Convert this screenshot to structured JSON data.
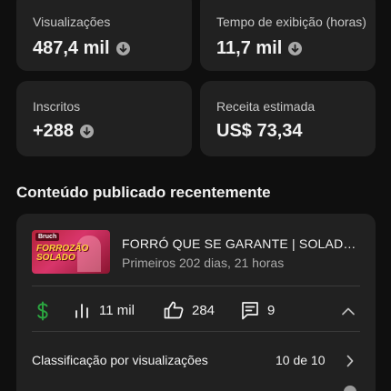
{
  "stats": [
    {
      "label": "Visualizações",
      "value": "487,4 mil",
      "trend_icon": "arrow-down-circle-icon"
    },
    {
      "label": "Tempo de exibição (horas)",
      "value": "11,7 mil",
      "trend_icon": "arrow-down-circle-icon"
    },
    {
      "label": "Inscritos",
      "value": "+288",
      "trend_icon": "arrow-down-circle-icon"
    },
    {
      "label": "Receita estimada",
      "value": "US$ 73,34"
    }
  ],
  "recent": {
    "section_title": "Conteúdo publicado recentemente",
    "video": {
      "thumbnail_text": "FORROZÃO SOLADO",
      "thumbnail_logo": "Bruch",
      "title": "FORRÓ QUE SE GARANTE | SOLADO...",
      "subtitle": "Primeiros 202 dias, 21 horas"
    },
    "metrics": {
      "revenue_icon": "dollar-icon",
      "views": "11 mil",
      "views_icon": "bar-chart-icon",
      "likes": "284",
      "likes_icon": "thumbs-up-icon",
      "comments": "9",
      "comments_icon": "comment-icon",
      "collapse_icon": "chevron-up-icon"
    },
    "ranking": {
      "label": "Classificação por visualizações",
      "value": "10 de 10",
      "icon": "chevron-right-icon"
    }
  },
  "colors": {
    "background": "#0f0f0f",
    "card": "#212121",
    "revenue_green": "#2ba640",
    "muted_text": "#aaaaaa"
  }
}
